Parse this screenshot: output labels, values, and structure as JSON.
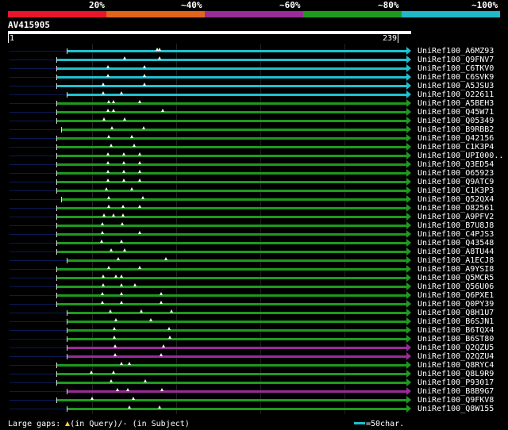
{
  "legend": {
    "labels": [
      "20%",
      "~40%",
      "~60%",
      "~80%",
      "~100%"
    ],
    "colors": [
      "#e8162c",
      "#e0641c",
      "#992c99",
      "#1f9a1f",
      "#20b8c8"
    ]
  },
  "query": {
    "name": "AV415905",
    "start": "1",
    "end": "239"
  },
  "hits": [
    {
      "name": "UniRef100_A6MZ93",
      "color": "#20c0d0"
    },
    {
      "name": "UniRef100_Q9FNV7",
      "color": "#20c0d0"
    },
    {
      "name": "UniRef100_C6TKV0",
      "color": "#20c0d0"
    },
    {
      "name": "UniRef100_C6SVK9",
      "color": "#20c0d0"
    },
    {
      "name": "UniRef100_A5JSU3",
      "color": "#20c0d0"
    },
    {
      "name": "UniRef100_O22611",
      "color": "#20c0d0"
    },
    {
      "name": "UniRef100_A5BEH3",
      "color": "#1f9a1f"
    },
    {
      "name": "UniRef100_Q45W71",
      "color": "#1f9a1f"
    },
    {
      "name": "UniRef100_Q05349",
      "color": "#1f9a1f"
    },
    {
      "name": "UniRef100_B9RBB2",
      "color": "#1f9a1f"
    },
    {
      "name": "UniRef100_Q42156",
      "color": "#1f9a1f"
    },
    {
      "name": "UniRef100_C1K3P4",
      "color": "#1f9a1f"
    },
    {
      "name": "UniRef100_UPI000..",
      "color": "#1f9a1f"
    },
    {
      "name": "UniRef100_Q3ED54",
      "color": "#1f9a1f"
    },
    {
      "name": "UniRef100_O65923",
      "color": "#1f9a1f"
    },
    {
      "name": "UniRef100_Q9ATC9",
      "color": "#1f9a1f"
    },
    {
      "name": "UniRef100_C1K3P3",
      "color": "#1f9a1f"
    },
    {
      "name": "UniRef100_Q52QX4",
      "color": "#1f9a1f"
    },
    {
      "name": "UniRef100_O82561",
      "color": "#1f9a1f"
    },
    {
      "name": "UniRef100_A9PFV2",
      "color": "#1f9a1f"
    },
    {
      "name": "UniRef100_B7U8J8",
      "color": "#1f9a1f"
    },
    {
      "name": "UniRef100_C4PJS3",
      "color": "#1f9a1f"
    },
    {
      "name": "UniRef100_Q43548",
      "color": "#1f9a1f"
    },
    {
      "name": "UniRef100_A8TU44",
      "color": "#1f9a1f"
    },
    {
      "name": "UniRef100_A1ECJ8",
      "color": "#1f9a1f"
    },
    {
      "name": "UniRef100_A9YSI8",
      "color": "#1f9a1f"
    },
    {
      "name": "UniRef100_Q5MCR5",
      "color": "#1f9a1f"
    },
    {
      "name": "UniRef100_Q56U06",
      "color": "#1f9a1f"
    },
    {
      "name": "UniRef100_Q6PXE1",
      "color": "#1f9a1f"
    },
    {
      "name": "UniRef100_Q0PY39",
      "color": "#1f9a1f"
    },
    {
      "name": "UniRef100_Q8H1U7",
      "color": "#1f9a1f"
    },
    {
      "name": "UniRef100_B6SJN1",
      "color": "#1f9a1f"
    },
    {
      "name": "UniRef100_B6TQX4",
      "color": "#1f9a1f"
    },
    {
      "name": "UniRef100_B6ST80",
      "color": "#1f9a1f"
    },
    {
      "name": "UniRef100_Q2QZU5",
      "color": "#992c99"
    },
    {
      "name": "UniRef100_Q2QZU4",
      "color": "#992c99"
    },
    {
      "name": "UniRef100_Q8RYC4",
      "color": "#1f9a1f"
    },
    {
      "name": "UniRef100_Q8L9R9",
      "color": "#1f9a1f"
    },
    {
      "name": "UniRef100_P93017",
      "color": "#1f9a1f"
    },
    {
      "name": "UniRef100_B8B9G7",
      "color": "#992c99"
    },
    {
      "name": "UniRef100_Q9FKV8",
      "color": "#1f9a1f"
    },
    {
      "name": "UniRef100_Q8W155",
      "color": "#1f9a1f"
    }
  ],
  "footer": {
    "large_gaps_label": "Large gaps:",
    "in_query": "(in Query)/",
    "in_subject": "(in Subject)",
    "scale_label": "=50char."
  }
}
